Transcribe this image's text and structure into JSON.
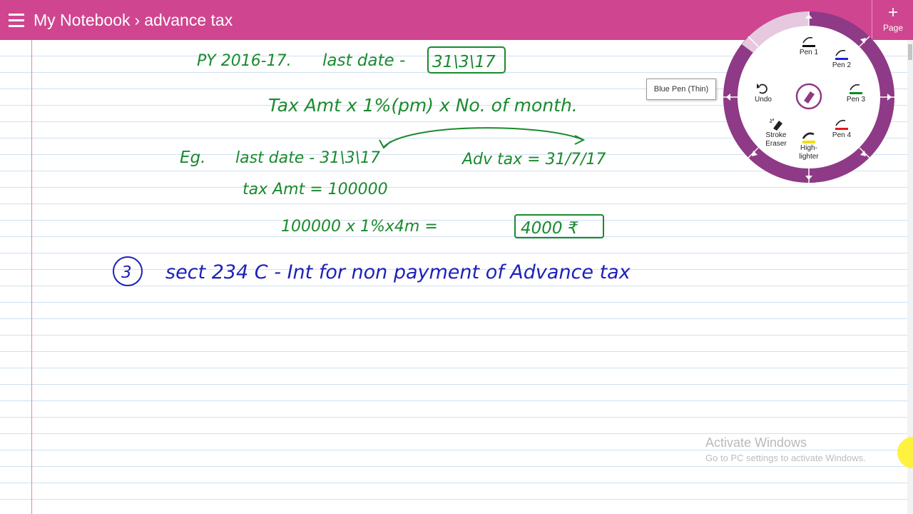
{
  "titlebar": {
    "notebook": "My Notebook",
    "separator": "›",
    "section": "advance tax",
    "page_button_label": "Page",
    "page_button_icon": "+"
  },
  "notes": {
    "line1_py": "PY 2016-17.",
    "line1_label": "last date -",
    "line1_date": "31\\3\\17",
    "line2_formula": "Tax Amt x 1%(pm) x No. of month.",
    "line3_eg": "Eg.",
    "line3_lastdate": "last date - 31\\3\\17",
    "line3_advtax": "Adv tax = 31/7/17",
    "line4_taxamt": "tax Amt = 100000",
    "line5_calc": "100000 x 1%x4m =",
    "line5_result": "4000 ₹",
    "line6_num": "3",
    "line6_text": "sect 234 C - Int for non payment of Advance tax"
  },
  "colors": {
    "titlebar": "#d0458f",
    "green_ink": "#1a8a2e",
    "blue_ink": "#1e22b8",
    "radial_ring": "#8e3a86"
  },
  "pen_menu": {
    "tooltip": "Blue Pen (Thin)",
    "tools": [
      {
        "label": "Pen 1",
        "icon": "pen-black-icon"
      },
      {
        "label": "Pen 2",
        "icon": "pen-blue-icon"
      },
      {
        "label": "Pen 3",
        "icon": "pen-green-icon"
      },
      {
        "label": "Pen 4",
        "icon": "pen-red-icon"
      },
      {
        "label": "Undo",
        "icon": "undo-icon"
      },
      {
        "label": "Stroke Eraser",
        "icon": "stroke-eraser-icon"
      },
      {
        "label": "High-lighter",
        "icon": "highlighter-icon"
      }
    ]
  },
  "watermark": {
    "title": "Activate Windows",
    "subtitle": "Go to PC settings to activate Windows."
  }
}
